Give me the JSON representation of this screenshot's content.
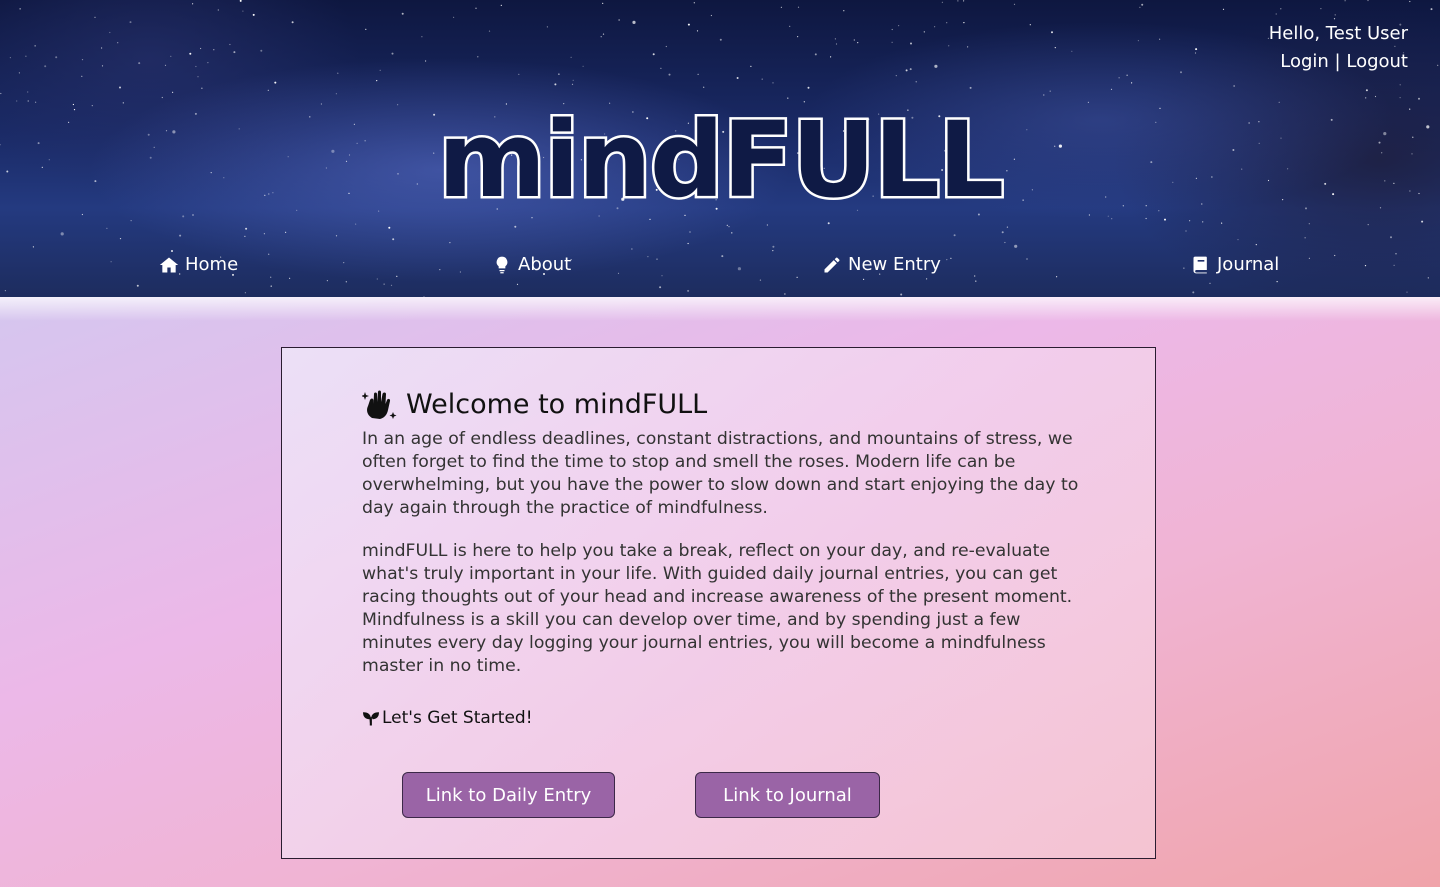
{
  "header": {
    "greeting": "Hello, Test User",
    "login_label": "Login",
    "separator": "|",
    "logout_label": "Logout",
    "logo_text": "mindFULL"
  },
  "nav": {
    "items": [
      {
        "label": "Home",
        "icon": "home-icon"
      },
      {
        "label": "About",
        "icon": "lightbulb-icon"
      },
      {
        "label": "New Entry",
        "icon": "pencil-icon"
      },
      {
        "label": "Journal",
        "icon": "book-icon"
      }
    ]
  },
  "main": {
    "welcome_title": "Welcome to mindFULL",
    "welcome_icon": "sparkle-hand-icon",
    "paragraph1": "In an age of endless deadlines, constant distractions, and mountains of stress, we often forget to find the time to stop and smell the roses. Modern life can be overwhelming, but you have the power to slow down and start enjoying the day to day again through the practice of mindfulness.",
    "paragraph2": "mindFULL is here to help you take a break, reflect on your day, and re-evaluate what's truly important in your life. With guided daily journal entries, you can get racing thoughts out of your head and increase awareness of the present moment. Mindfulness is a skill you can develop over time, and by spending just a few minutes every day logging your journal entries, you will become a mindfulness master in no time.",
    "started_label": "Let's Get Started!",
    "started_icon": "seedling-icon",
    "button_daily": "Link to Daily Entry",
    "button_journal": "Link to Journal"
  },
  "colors": {
    "button_bg": "#9a64a6",
    "header_bg": "#1a2a66"
  }
}
